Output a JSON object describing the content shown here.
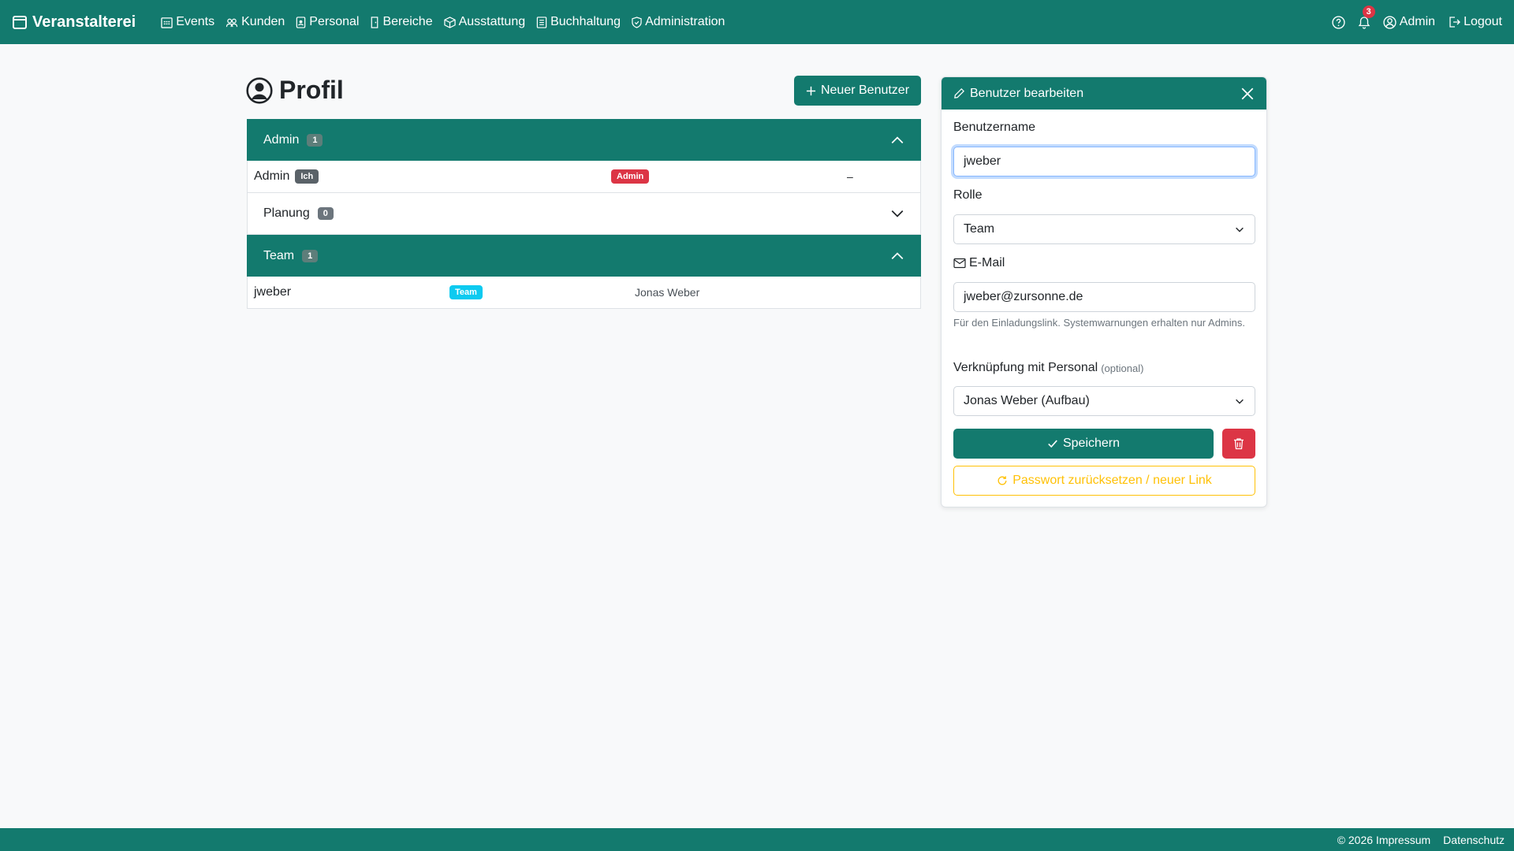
{
  "navbar": {
    "brand": "Veranstalterei",
    "items": [
      {
        "label": "Events"
      },
      {
        "label": "Kunden"
      },
      {
        "label": "Personal"
      },
      {
        "label": "Bereiche"
      },
      {
        "label": "Ausstattung"
      },
      {
        "label": "Buchhaltung"
      },
      {
        "label": "Administration"
      }
    ],
    "notification_count": "3",
    "user_label": "Admin",
    "logout_label": "Logout"
  },
  "page": {
    "title": "Profil",
    "new_user_button": "Neuer Benutzer"
  },
  "groups": [
    {
      "name": "Admin",
      "count": "1",
      "expanded": true,
      "rows": [
        {
          "username": "Admin",
          "self_badge": "Ich",
          "role_badge": "Admin",
          "role_color": "#dc3545",
          "personal": "–"
        }
      ]
    },
    {
      "name": "Planung",
      "count": "0",
      "expanded": false,
      "rows": []
    },
    {
      "name": "Team",
      "count": "1",
      "expanded": true,
      "rows": [
        {
          "username": "jweber",
          "role_badge": "Team",
          "role_color": "#0dcaf0",
          "personal": "Jonas Weber"
        }
      ]
    }
  ],
  "edit_panel": {
    "title": "Benutzer bearbeiten",
    "username_label": "Benutzername",
    "username_value": "jweber",
    "role_label": "Rolle",
    "role_value": "Team",
    "email_label": "E-Mail",
    "email_value": "jweber@zursonne.de",
    "email_help": "Für den Einladungslink. Systemwarnungen erhalten nur Admins.",
    "link_label": "Verknüpfung mit Personal",
    "link_optional": "(optional)",
    "link_value": "Jonas Weber (Aufbau)",
    "save_button": "Speichern",
    "reset_button": "Passwort zurücksetzen / neuer Link"
  },
  "footer": {
    "impressum": "© 2026 Impressum",
    "privacy": "Datenschutz"
  },
  "colors": {
    "primary": "#137a6e",
    "danger": "#dc3545",
    "info": "#0dcaf0",
    "warning": "#ffc107"
  }
}
